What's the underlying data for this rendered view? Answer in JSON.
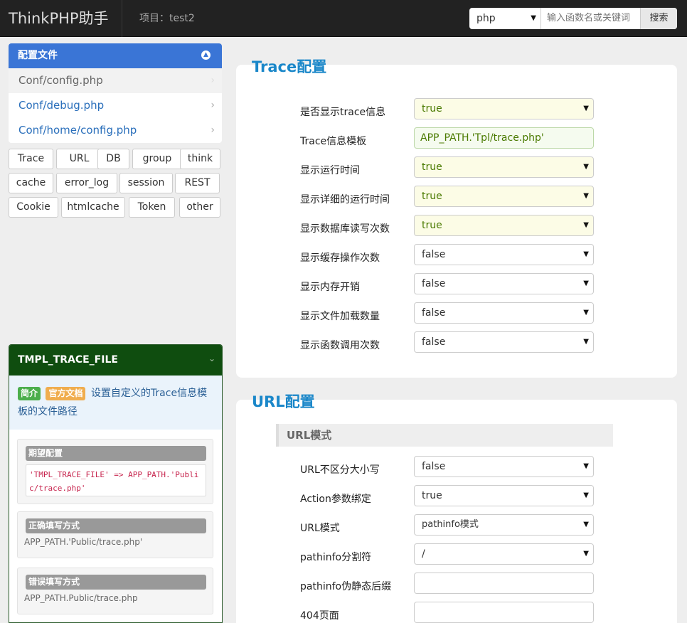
{
  "app": {
    "title": "ThinkPHP助手",
    "project": "项目：test2"
  },
  "search": {
    "language": "php",
    "placeholder": "输入函数名或关键词",
    "button": "搜索"
  },
  "sidebar": {
    "config_header": "配置文件",
    "config_items": [
      {
        "label": "Conf/config.php"
      },
      {
        "label": "Conf/debug.php"
      },
      {
        "label": "Conf/home/config.php"
      }
    ],
    "tags": [
      "Trace",
      "URL",
      "DB",
      "group",
      "think",
      "cache",
      "error_log",
      "session",
      "REST",
      "Cookie",
      "htmlcache",
      "Token",
      "other"
    ]
  },
  "tip": {
    "title": "TMPL_TRACE_FILE",
    "badge_intro": "简介",
    "badge_doc": "官方文档",
    "description": "设置自定义的Trace信息模板的文件路径",
    "expected_title": "期望配置",
    "expected_code": "'TMPL_TRACE_FILE' => APP_PATH.'Public/trace.php'",
    "correct_title": "正确填写方式",
    "correct_value": "APP_PATH.'Public/trace.php'",
    "wrong_title": "错误填写方式",
    "wrong_value": "APP_PATH.Public/trace.php"
  },
  "trace": {
    "title": "Trace配置",
    "rows": [
      {
        "label": "是否显示trace信息",
        "value": "true",
        "type": "select",
        "highlight": true
      },
      {
        "label": "Trace信息模板",
        "value": "APP_PATH.'Tpl/trace.php'",
        "type": "text",
        "highlight": true
      },
      {
        "label": "显示运行时间",
        "value": "true",
        "type": "select",
        "highlight": true
      },
      {
        "label": "显示详细的运行时间",
        "value": "true",
        "type": "select",
        "highlight": true
      },
      {
        "label": "显示数据库读写次数",
        "value": "true",
        "type": "select",
        "highlight": true
      },
      {
        "label": "显示缓存操作次数",
        "value": "false",
        "type": "select",
        "highlight": false
      },
      {
        "label": "显示内存开销",
        "value": "false",
        "type": "select",
        "highlight": false
      },
      {
        "label": "显示文件加载数量",
        "value": "false",
        "type": "select",
        "highlight": false
      },
      {
        "label": "显示函数调用次数",
        "value": "false",
        "type": "select",
        "highlight": false
      }
    ]
  },
  "url": {
    "title": "URL配置",
    "subtitle": "URL模式",
    "rows": [
      {
        "label": "URL不区分大小写",
        "value": "false",
        "type": "select"
      },
      {
        "label": "Action参数绑定",
        "value": "true",
        "type": "select"
      },
      {
        "label": "URL模式",
        "value": "pathinfo模式",
        "type": "select"
      },
      {
        "label": "pathinfo分割符",
        "value": "/",
        "type": "select"
      },
      {
        "label": "pathinfo伪静态后缀",
        "value": "",
        "type": "text"
      },
      {
        "label": "404页面",
        "value": "",
        "type": "text"
      }
    ]
  }
}
